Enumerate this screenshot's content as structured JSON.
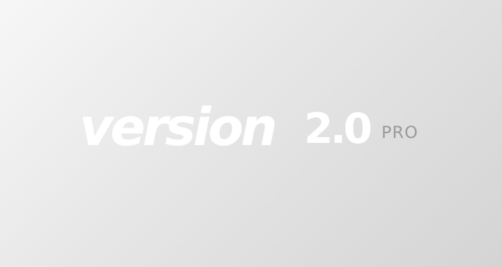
{
  "splash": {
    "wordmark": "version",
    "version_number": "2.0",
    "edition": "PRO"
  }
}
